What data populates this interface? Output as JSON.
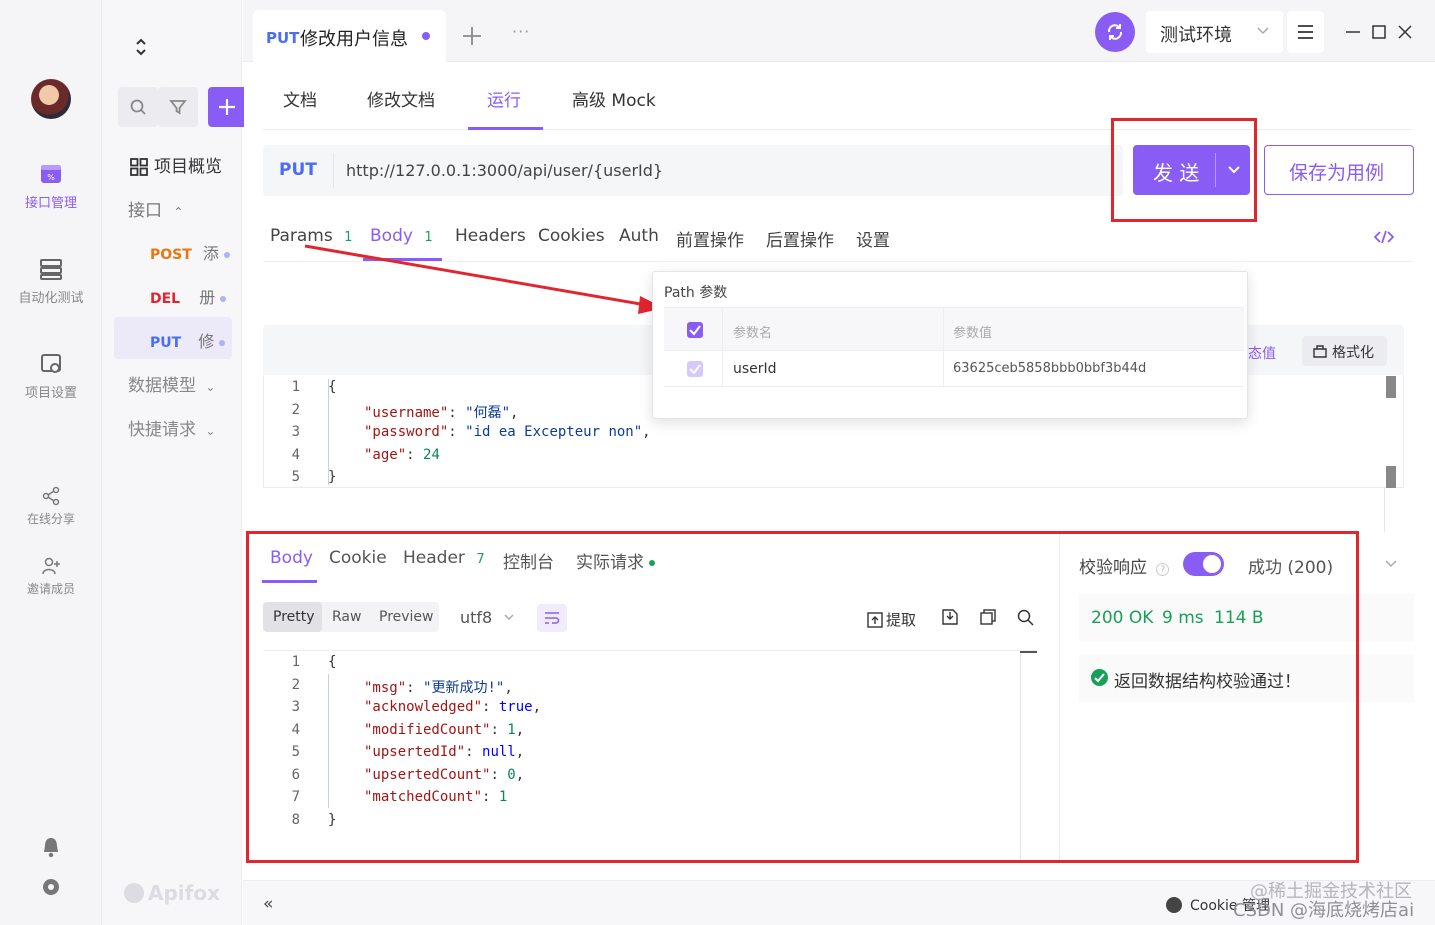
{
  "rail": {
    "items": [
      {
        "label": "接口管理"
      },
      {
        "label": "自动化测试"
      },
      {
        "label": "项目设置"
      },
      {
        "label": "在线分享"
      },
      {
        "label": "邀请成员"
      }
    ]
  },
  "sidebar": {
    "overview": "项目概览",
    "api_group": "接口",
    "apis": [
      {
        "method": "POST",
        "name": "添"
      },
      {
        "method": "DEL",
        "name": "册"
      },
      {
        "method": "PUT",
        "name": "修"
      }
    ],
    "models": "数据模型",
    "quick": "快捷请求",
    "brand": "Apifox"
  },
  "tabbar": {
    "tab_method": "PUT",
    "tab_title": "修改用户信息",
    "more": "···",
    "env": "测试环境"
  },
  "subtabs": [
    "文档",
    "修改文档",
    "运行",
    "高级 Mock"
  ],
  "request": {
    "method": "PUT",
    "url": "http://127.0.0.1:3000/api/user/{userId}",
    "send": "发 送",
    "save": "保存为用例"
  },
  "params_tabs": {
    "params": "Params",
    "params_count": "1",
    "body": "Body",
    "body_count": "1",
    "headers": "Headers",
    "cookies": "Cookies",
    "auth": "Auth",
    "pre": "前置操作",
    "post": "后置操作",
    "settings": "设置"
  },
  "path_popup": {
    "title": "Path 参数",
    "col_name": "参数名",
    "col_value": "参数值",
    "row_name": "userId",
    "row_value": "63625ceb5858bbb0bbf3b44d"
  },
  "body_toolbar": {
    "dynamic": "态值",
    "format": "格式化"
  },
  "request_body": [
    {
      "n": "1",
      "text": "{"
    },
    {
      "n": "2",
      "key": "\"username\"",
      "val": "\"何磊\"",
      "tail": ","
    },
    {
      "n": "3",
      "key": "\"password\"",
      "val": "\"id ea Excepteur non\"",
      "tail": ","
    },
    {
      "n": "4",
      "key": "\"age\"",
      "num": "24"
    },
    {
      "n": "5",
      "text": "}"
    }
  ],
  "response_tabs": {
    "body": "Body",
    "cookie": "Cookie",
    "header": "Header",
    "header_count": "7",
    "console": "控制台",
    "actual": "实际请求"
  },
  "response_toolbar": {
    "pretty": "Pretty",
    "raw": "Raw",
    "preview": "Preview",
    "encoding": "utf8",
    "extract": "提取"
  },
  "response_body": [
    {
      "n": "1",
      "text": "{"
    },
    {
      "n": "2",
      "key": "\"msg\"",
      "val": "\"更新成功!\"",
      "tail": ","
    },
    {
      "n": "3",
      "key": "\"acknowledged\"",
      "kwv": "true",
      "tail": ","
    },
    {
      "n": "4",
      "key": "\"modifiedCount\"",
      "num": "1",
      "tail": ","
    },
    {
      "n": "5",
      "key": "\"upsertedId\"",
      "kwv": "null",
      "tail": ","
    },
    {
      "n": "6",
      "key": "\"upsertedCount\"",
      "num": "0",
      "tail": ","
    },
    {
      "n": "7",
      "key": "\"matchedCount\"",
      "num": "1"
    },
    {
      "n": "8",
      "text": "}"
    }
  ],
  "validation": {
    "label": "校验响应",
    "result": "成功 (200)",
    "status": "200 OK",
    "time": "9 ms",
    "size": "114 B",
    "message": "返回数据结构校验通过！"
  },
  "footer": {
    "cookie": "Cookie 管理",
    "watermark1": "@稀土掘金技术社区",
    "watermark2": "CSDN @海底烧烤店ai"
  },
  "colors": {
    "accent": "#8a5cf6",
    "success": "#18a058",
    "highlight": "#e0262f"
  }
}
